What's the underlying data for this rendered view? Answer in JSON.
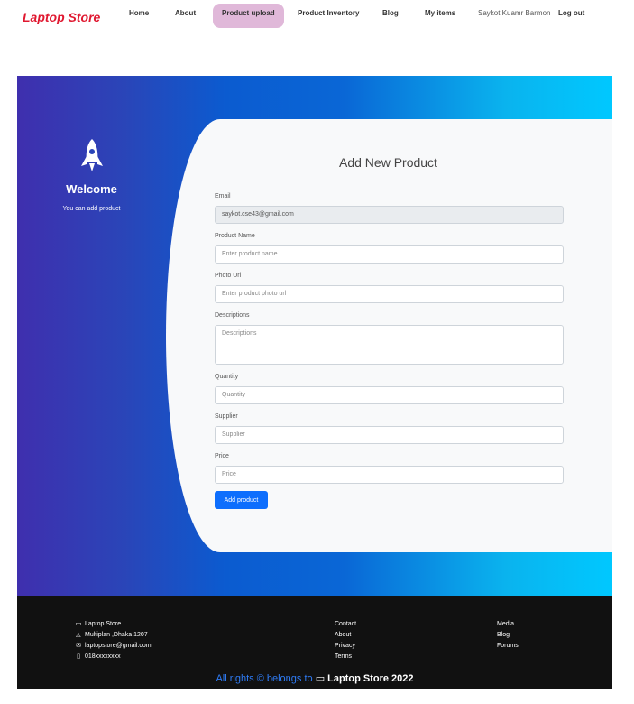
{
  "brand": "Laptop Store",
  "nav": {
    "home": "Home",
    "about": "About",
    "upload": "Product upload",
    "inventory": "Product Inventory",
    "blog": "Blog",
    "my_items": "My items",
    "user": "Saykot Kuamr Barmon",
    "logout": "Log out"
  },
  "welcome": {
    "title": "Welcome",
    "subtitle": "You can add product"
  },
  "form": {
    "title": "Add New Product",
    "email_label": "Email",
    "email_value": "saykot.cse43@gmail.com",
    "name_label": "Product Name",
    "name_placeholder": "Enter product name",
    "photo_label": "Photo Url",
    "photo_placeholder": "Enter product photo url",
    "desc_label": "Descriptions",
    "desc_placeholder": "Descriptions",
    "qty_label": "Quantity",
    "qty_placeholder": "Quantity",
    "supplier_label": "Supplier",
    "supplier_placeholder": "Supplier",
    "price_label": "Price",
    "price_placeholder": "Price",
    "submit": "Add product"
  },
  "footer": {
    "store": "Laptop Store",
    "address": "Multiplan ,Dhaka 1207",
    "email": "laptopstore@gmail.com",
    "phone": "018xxxxxxxx",
    "links1": [
      "Contact",
      "About",
      "Privacy",
      "Terms"
    ],
    "links2": [
      "Media",
      "Blog",
      "Forums"
    ],
    "copyright_prefix": "All rights © belongs to",
    "copyright_brand": "Laptop Store 2022"
  },
  "colors": {
    "brand": "#e01830",
    "active_tab": "#e0b8d9",
    "button": "#0d6efd",
    "footer_bg": "#111111",
    "copyright_link": "#2f7cf6"
  }
}
